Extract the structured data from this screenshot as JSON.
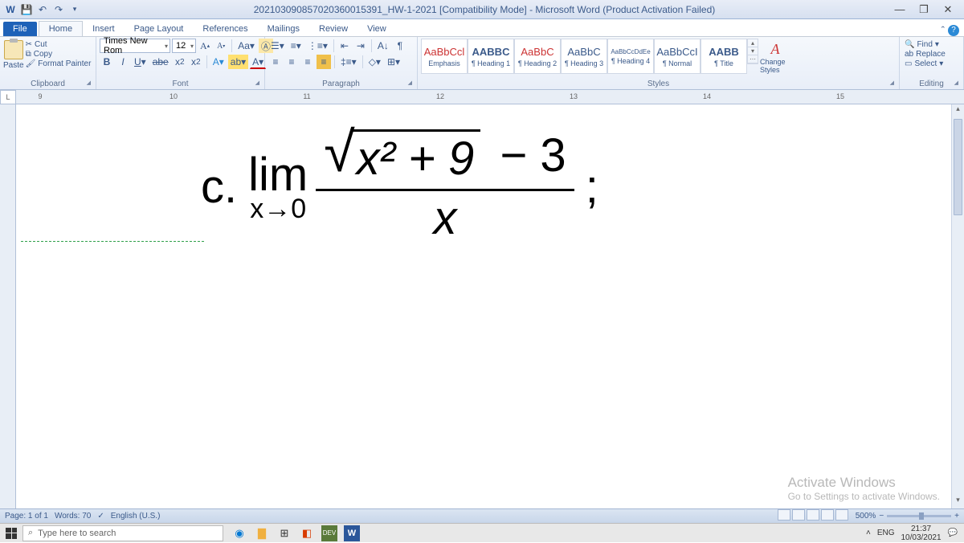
{
  "title": "202103090857020360015391_HW-1-2021 [Compatibility Mode] - Microsoft Word (Product Activation Failed)",
  "tabs": {
    "file": "File",
    "home": "Home",
    "insert": "Insert",
    "pagelayout": "Page Layout",
    "references": "References",
    "mailings": "Mailings",
    "review": "Review",
    "view": "View"
  },
  "clipboard": {
    "label": "Clipboard",
    "paste": "Paste",
    "cut": "Cut",
    "copy": "Copy",
    "fmt": "Format Painter"
  },
  "font": {
    "label": "Font",
    "name": "Times New Rom",
    "size": "12"
  },
  "paragraph": {
    "label": "Paragraph"
  },
  "styles": {
    "label": "Styles",
    "items": [
      {
        "preview": "AaBbCcl",
        "name": "Emphasis",
        "color": "#c33"
      },
      {
        "preview": "AABBC",
        "name": "¶ Heading 1",
        "bold": true
      },
      {
        "preview": "AaBbC",
        "name": "¶ Heading 2",
        "color": "#c33"
      },
      {
        "preview": "AaBbC",
        "name": "¶ Heading 3"
      },
      {
        "preview": "AaBbCcDdEe",
        "name": "¶ Heading 4",
        "small": true
      },
      {
        "preview": "AaBbCcI",
        "name": "¶ Normal"
      },
      {
        "preview": "AABB",
        "name": "¶ Title",
        "bold": true
      }
    ],
    "change": "Change Styles"
  },
  "editing": {
    "label": "Editing",
    "find": "Find",
    "replace": "Replace",
    "select": "Select"
  },
  "ruler": [
    "9",
    "10",
    "11",
    "12",
    "13",
    "14",
    "15"
  ],
  "math": {
    "label": "c.",
    "lim": "lim",
    "limsub": "x→0",
    "radicand": "x² + 9",
    "minus": "− 3",
    "denom": "x",
    "semi": ";"
  },
  "watermark": {
    "line1": "Activate Windows",
    "line2": "Go to Settings to activate Windows."
  },
  "status": {
    "page": "Page: 1 of 1",
    "words": "Words: 70",
    "lang": "English (U.S.)",
    "zoom": "500%"
  },
  "taskbar": {
    "search": "Type here to search",
    "lang": "ENG",
    "time": "21:37",
    "date": "10/03/2021"
  }
}
